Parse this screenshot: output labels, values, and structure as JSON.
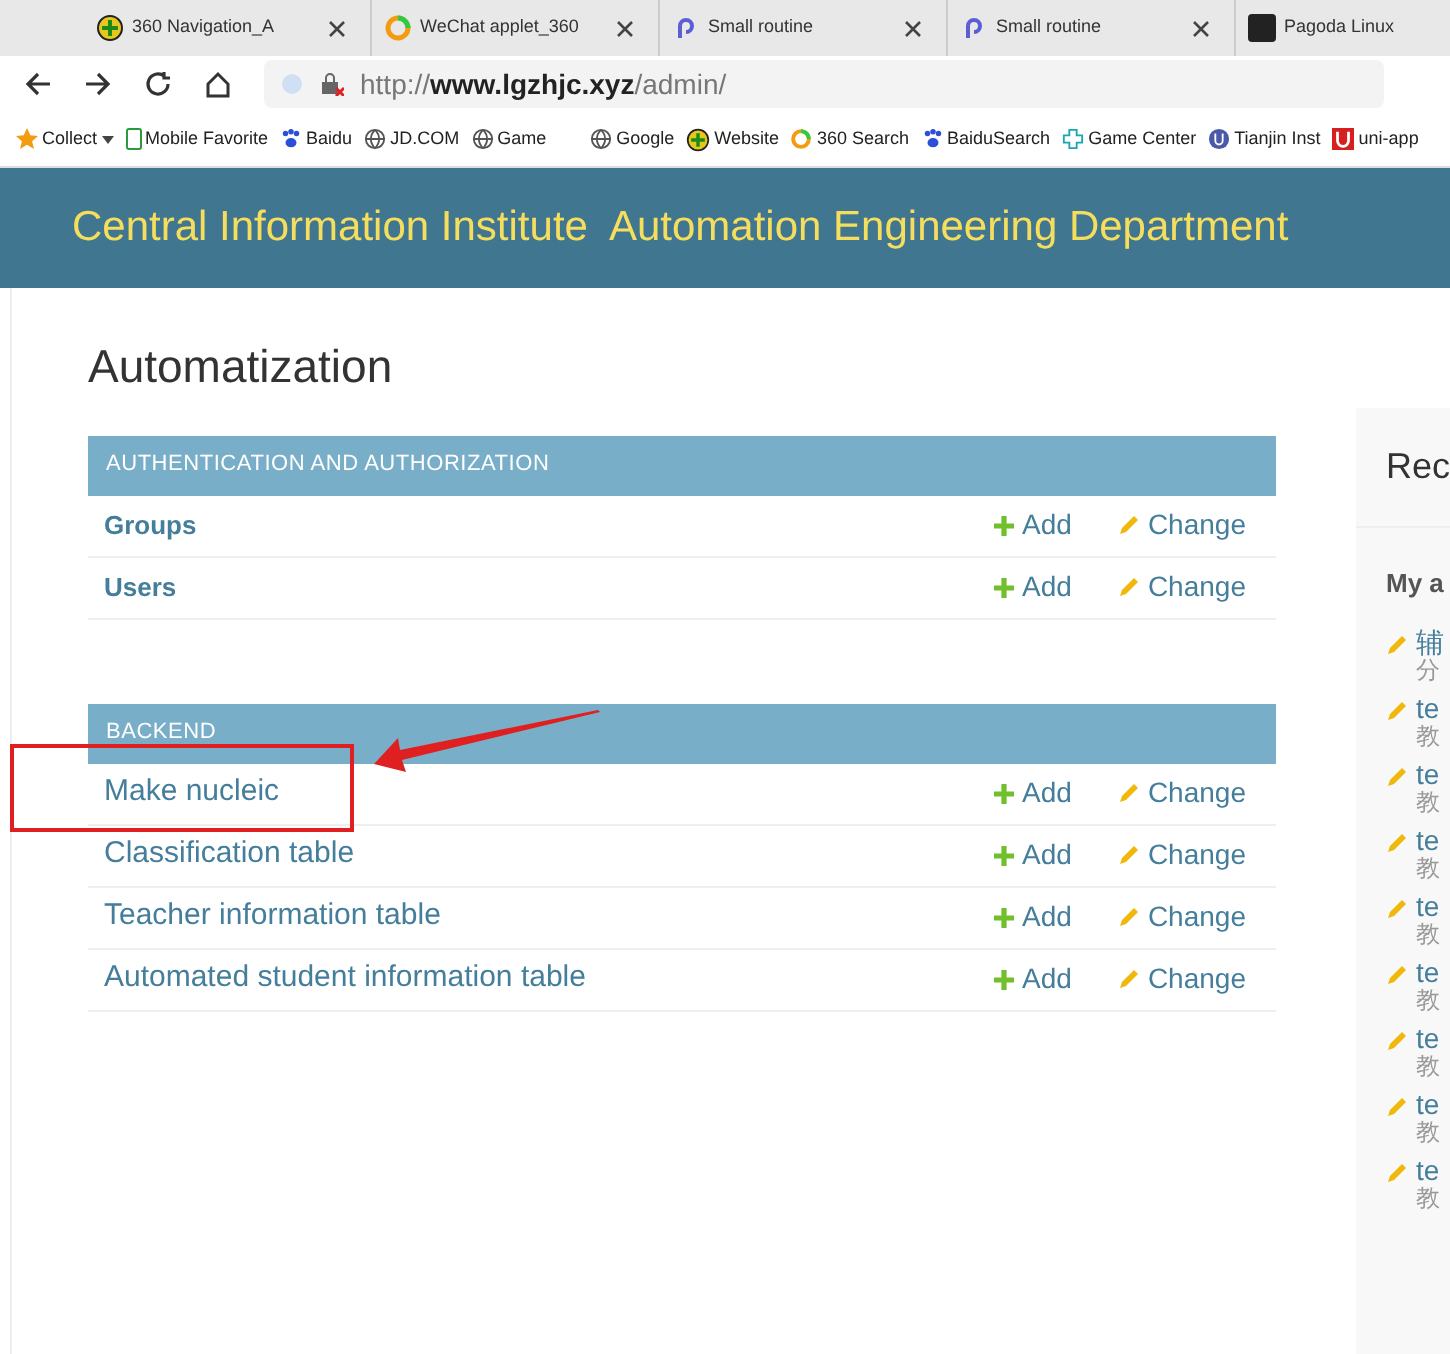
{
  "tabs": [
    {
      "title": "360 Navigation_A"
    },
    {
      "title": "WeChat applet_360"
    },
    {
      "title": "Small routine"
    },
    {
      "title": "Small routine"
    },
    {
      "title": "Pagoda Linux"
    }
  ],
  "address_bar": {
    "scheme": "http://",
    "host": "www.lgzhjc.xyz",
    "path": "/admin/"
  },
  "bookmarks": [
    "Collect",
    "Mobile Favorite",
    "Baidu",
    "JD.COM",
    "Game",
    "Google",
    "Website",
    "360 Search",
    "BaiduSearch",
    "Game Center",
    "Tianjin Inst",
    "uni-app"
  ],
  "header": {
    "title": "Central Information Institute  Automation Engineering Department"
  },
  "page_title": "Automatization",
  "modules": [
    {
      "caption": "AUTHENTICATION AND AUTHORIZATION",
      "bold_rows": true,
      "rows": [
        {
          "name": "Groups",
          "add": "Add",
          "change": "Change"
        },
        {
          "name": "Users",
          "add": "Add",
          "change": "Change"
        }
      ]
    },
    {
      "caption": "BACKEND",
      "bold_rows": false,
      "rows": [
        {
          "name": "Make nucleic",
          "add": "Add",
          "change": "Change",
          "highlighted": true
        },
        {
          "name": "Classification table",
          "add": "Add",
          "change": "Change",
          "highlighted": false
        },
        {
          "name": "Teacher information table",
          "add": "Add",
          "change": "Change",
          "highlighted": false
        },
        {
          "name": "Automated student information table",
          "add": "Add",
          "change": "Change",
          "highlighted": false
        }
      ]
    }
  ],
  "recent_actions": {
    "title": "Rec",
    "subtitle": "My a",
    "items": [
      {
        "title": "辅",
        "detail": "分"
      },
      {
        "title": "te",
        "detail": "教"
      },
      {
        "title": "te",
        "detail": "教"
      },
      {
        "title": "te",
        "detail": "教"
      },
      {
        "title": "te",
        "detail": "教"
      },
      {
        "title": "te",
        "detail": "教"
      },
      {
        "title": "te",
        "detail": "教"
      },
      {
        "title": "te",
        "detail": "教"
      },
      {
        "title": "te",
        "detail": "教"
      }
    ]
  }
}
